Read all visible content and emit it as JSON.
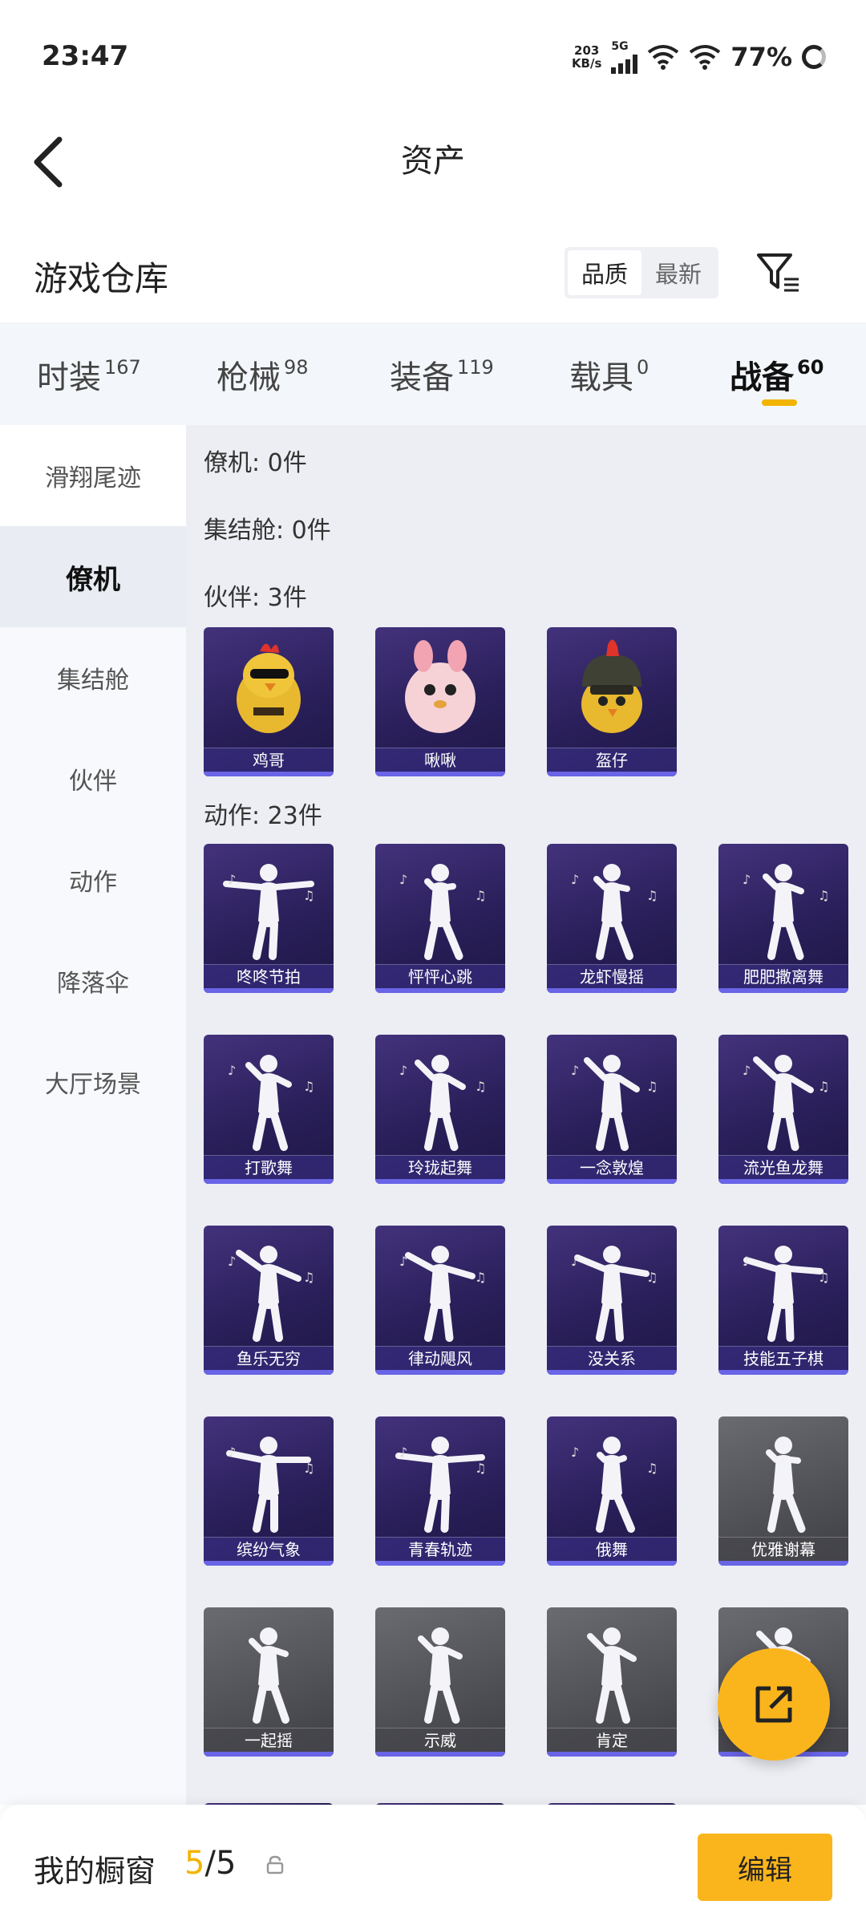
{
  "status": {
    "time": "23:47",
    "net_speed_value": "203",
    "net_speed_unit": "KB/s",
    "network": "5G",
    "battery": "77%"
  },
  "nav": {
    "title": "资产"
  },
  "warehouse": {
    "title": "游戏仓库",
    "sort_options": [
      "品质",
      "最新"
    ],
    "sort_selected": "品质"
  },
  "tabs": [
    {
      "label": "时装",
      "count": "167"
    },
    {
      "label": "枪械",
      "count": "98"
    },
    {
      "label": "装备",
      "count": "119"
    },
    {
      "label": "载具",
      "count": "0"
    },
    {
      "label": "战备",
      "count": "60",
      "active": true
    }
  ],
  "sidebar": [
    {
      "label": "滑翔尾迹"
    },
    {
      "label": "僚机",
      "active": true
    },
    {
      "label": "集结舱"
    },
    {
      "label": "伙伴"
    },
    {
      "label": "动作"
    },
    {
      "label": "降落伞"
    },
    {
      "label": "大厅场景"
    }
  ],
  "sections": {
    "wingman": "僚机: 0件",
    "rally_pod": "集结舱: 0件",
    "companion": "伙伴: 3件",
    "emote": "动作: 23件"
  },
  "companions": [
    {
      "name": "鸡哥",
      "icon": "chicken-icon"
    },
    {
      "name": "啾啾",
      "icon": "pink-bird-icon"
    },
    {
      "name": "盔仔",
      "icon": "helmet-chick-icon"
    }
  ],
  "emotes": [
    {
      "name": "咚咚节拍",
      "rarity": "purple"
    },
    {
      "name": "怦怦心跳",
      "rarity": "purple"
    },
    {
      "name": "龙虾慢摇",
      "rarity": "purple"
    },
    {
      "name": "肥肥撒离舞",
      "rarity": "purple"
    },
    {
      "name": "打歌舞",
      "rarity": "purple"
    },
    {
      "name": "玲珑起舞",
      "rarity": "purple"
    },
    {
      "name": "一念敦煌",
      "rarity": "purple"
    },
    {
      "name": "流光鱼龙舞",
      "rarity": "purple"
    },
    {
      "name": "鱼乐无穷",
      "rarity": "purple"
    },
    {
      "name": "律动飓风",
      "rarity": "purple"
    },
    {
      "name": "没关系",
      "rarity": "purple"
    },
    {
      "name": "技能五子棋",
      "rarity": "purple"
    },
    {
      "name": "缤纷气象",
      "rarity": "purple"
    },
    {
      "name": "青春轨迹",
      "rarity": "purple"
    },
    {
      "name": "俄舞",
      "rarity": "purple"
    },
    {
      "name": "优雅谢幕",
      "rarity": "gray"
    },
    {
      "name": "一起摇",
      "rarity": "gray"
    },
    {
      "name": "示威",
      "rarity": "gray"
    },
    {
      "name": "肯定",
      "rarity": "gray"
    },
    {
      "name": "",
      "rarity": "gray"
    }
  ],
  "bottom": {
    "label": "我的橱窗",
    "count_current": "5",
    "count_sep": "/",
    "count_total": "5",
    "edit_label": "编辑"
  }
}
